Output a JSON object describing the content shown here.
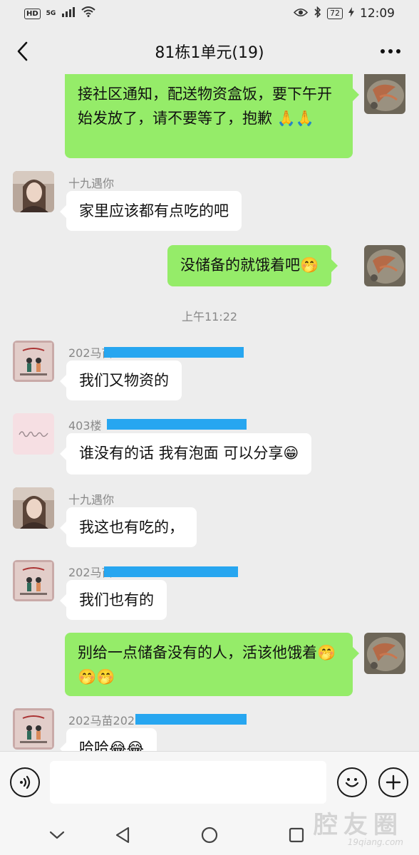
{
  "status_bar": {
    "hd_label": "HD",
    "network_label": "5G",
    "battery": "72",
    "time": "12:09"
  },
  "header": {
    "title": "81栋1单元(19)"
  },
  "messages": [
    {
      "type": "outgoing",
      "text": "接社区通知，配送物资盒饭，要下午开始发放了，请不要等了，抱歉",
      "emoji": "🙏🙏"
    },
    {
      "type": "incoming",
      "sender": "十九遇你",
      "text": "家里应该都有点吃的吧"
    },
    {
      "type": "outgoing",
      "text": "没储备的就饿着吧",
      "emoji": "🤭"
    },
    {
      "type": "time",
      "text": "上午11:22"
    },
    {
      "type": "incoming",
      "sender": "202马苗",
      "text": "我们又物资的"
    },
    {
      "type": "incoming",
      "sender": "403楼",
      "text": "谁没有的话 我有泡面 可以分享",
      "emoji": "😁"
    },
    {
      "type": "incoming",
      "sender": "十九遇你",
      "text": "我这也有吃的，"
    },
    {
      "type": "incoming",
      "sender": "202马苗",
      "text": "我们也有的"
    },
    {
      "type": "outgoing",
      "text": "别给一点储备没有的人，活该他饿着",
      "emoji": "🤭🤭🤭"
    },
    {
      "type": "incoming",
      "sender": "202马苗202",
      "text": "哈哈",
      "emoji": "😂😂"
    }
  ],
  "icons": {
    "back": "chevron-left-icon",
    "more": "more-dots-icon",
    "voice": "voice-icon",
    "emoji": "emoji-icon",
    "add": "plus-icon",
    "nav_down": "chevron-down-icon",
    "nav_back": "triangle-back-icon",
    "nav_home": "circle-home-icon",
    "nav_recent": "square-recent-icon"
  },
  "colors": {
    "outgoing_bubble": "#95ec69",
    "incoming_bubble": "#ffffff",
    "background": "#ededed",
    "redaction": "#27a6f0"
  },
  "watermark": {
    "text": "腔友圈",
    "url": "19qiang.com"
  },
  "composer": {
    "value": ""
  }
}
